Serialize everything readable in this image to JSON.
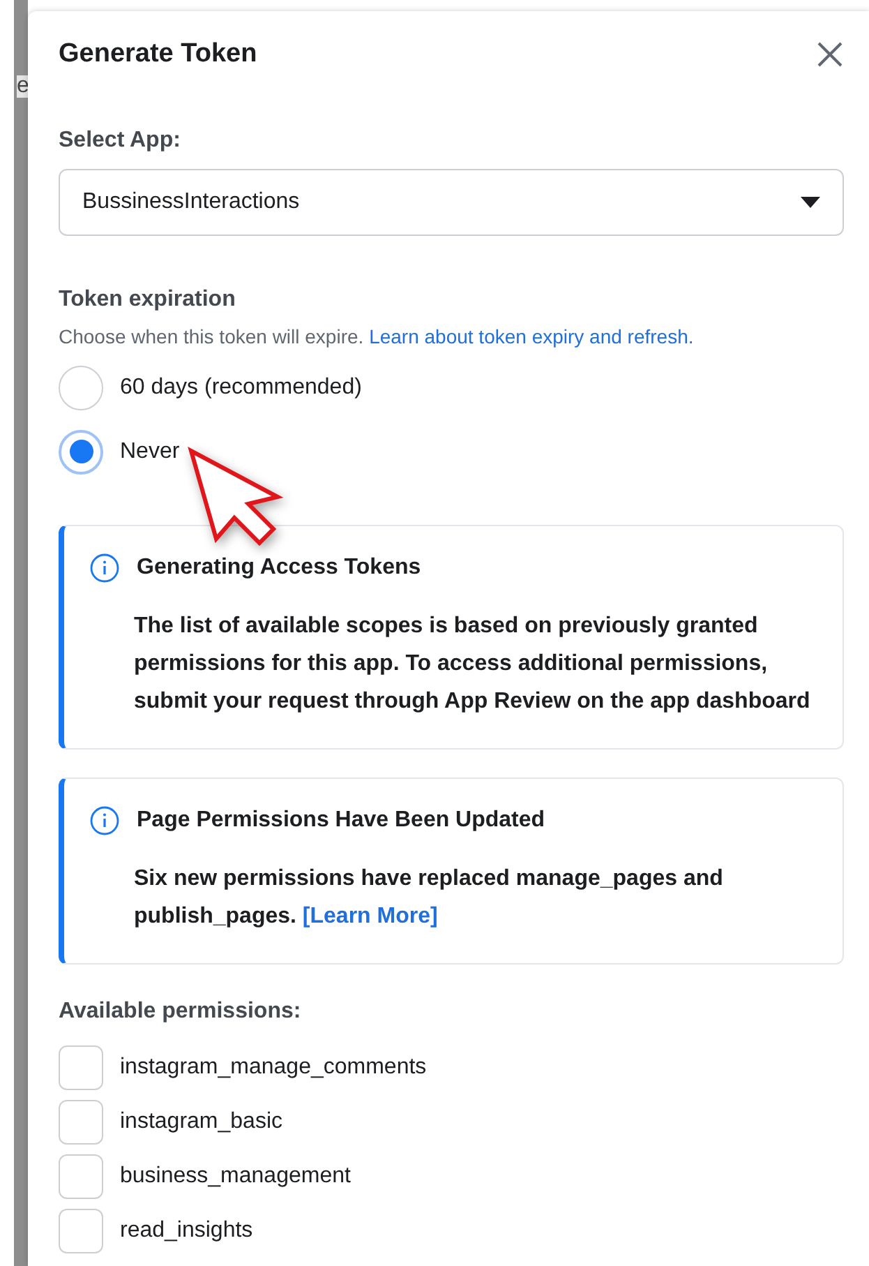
{
  "background": {
    "text": "e"
  },
  "dialog": {
    "title": "Generate Token"
  },
  "select_app": {
    "label": "Select App:",
    "value": "BussinessInteractions"
  },
  "token_expiration": {
    "label": "Token expiration",
    "description": "Choose when this token will expire.",
    "link": "Learn about token expiry and refresh.",
    "options": [
      {
        "label": "60 days (recommended)",
        "selected": false
      },
      {
        "label": "Never",
        "selected": true
      }
    ]
  },
  "notices": [
    {
      "title": "Generating Access Tokens",
      "body": "The list of available scopes is based on previously granted permissions for this app. To access additional permissions, submit your request through App Review on the app dashboard"
    },
    {
      "title": "Page Permissions Have Been Updated",
      "body": "Six new permissions have replaced manage_pages and publish_pages.",
      "link": "[Learn More]"
    }
  ],
  "permissions": {
    "label": "Available permissions:",
    "items": [
      {
        "name": "instagram_manage_comments",
        "checked": false
      },
      {
        "name": "instagram_basic",
        "checked": false
      },
      {
        "name": "business_management",
        "checked": false
      },
      {
        "name": "read_insights",
        "checked": false
      }
    ]
  }
}
